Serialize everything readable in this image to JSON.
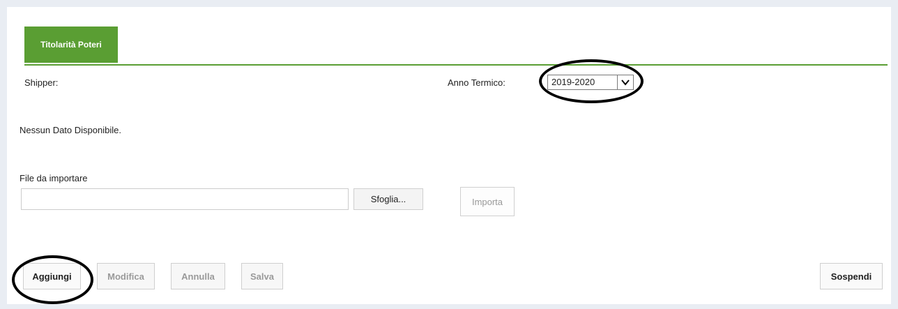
{
  "tab": {
    "label": "Titolarità Poteri"
  },
  "shipper": {
    "label": "Shipper:"
  },
  "anno_termico": {
    "label": "Anno Termico:",
    "selected": "2019-2020"
  },
  "status": {
    "message": "Nessun Dato Disponibile."
  },
  "import": {
    "label": "File da importare",
    "file_value": "",
    "browse_label": "Sfoglia...",
    "import_label": "Importa"
  },
  "actions": {
    "aggiungi": "Aggiungi",
    "modifica": "Modifica",
    "annulla": "Annulla",
    "salva": "Salva",
    "sospendi": "Sospendi"
  },
  "colors": {
    "accent": "#5a9e33",
    "background": "#e9edf3"
  },
  "icons": {
    "select_arrow": "chevron-down-icon"
  }
}
